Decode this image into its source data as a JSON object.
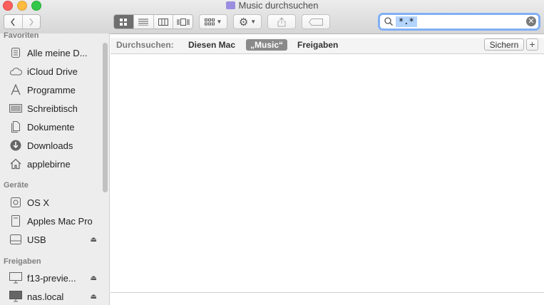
{
  "window": {
    "title": "Music durchsuchen"
  },
  "search": {
    "query": "*.*"
  },
  "sidebar": {
    "favorites_label": "Favoriten",
    "favorites": [
      {
        "label": "Alle meine D...",
        "icon": "all-files-icon"
      },
      {
        "label": "iCloud Drive",
        "icon": "cloud-icon"
      },
      {
        "label": "Programme",
        "icon": "applications-icon"
      },
      {
        "label": "Schreibtisch",
        "icon": "desktop-icon"
      },
      {
        "label": "Dokumente",
        "icon": "document-icon"
      },
      {
        "label": "Downloads",
        "icon": "download-icon"
      },
      {
        "label": "applebirne",
        "icon": "home-icon"
      }
    ],
    "devices_label": "Geräte",
    "devices": [
      {
        "label": "OS X",
        "icon": "drive-icon"
      },
      {
        "label": "Apples Mac Pro",
        "icon": "computer-icon"
      },
      {
        "label": "USB",
        "icon": "usb-drive-icon"
      }
    ],
    "shared_label": "Freigaben",
    "shared": [
      {
        "label": "f13-previe...",
        "icon": "display-icon"
      },
      {
        "label": "nas.local",
        "icon": "display-icon"
      }
    ]
  },
  "scope": {
    "label": "Durchsuchen:",
    "options": [
      "Diesen Mac",
      "„Music“",
      "Freigaben"
    ],
    "save_label": "Sichern",
    "add_label": "+"
  }
}
